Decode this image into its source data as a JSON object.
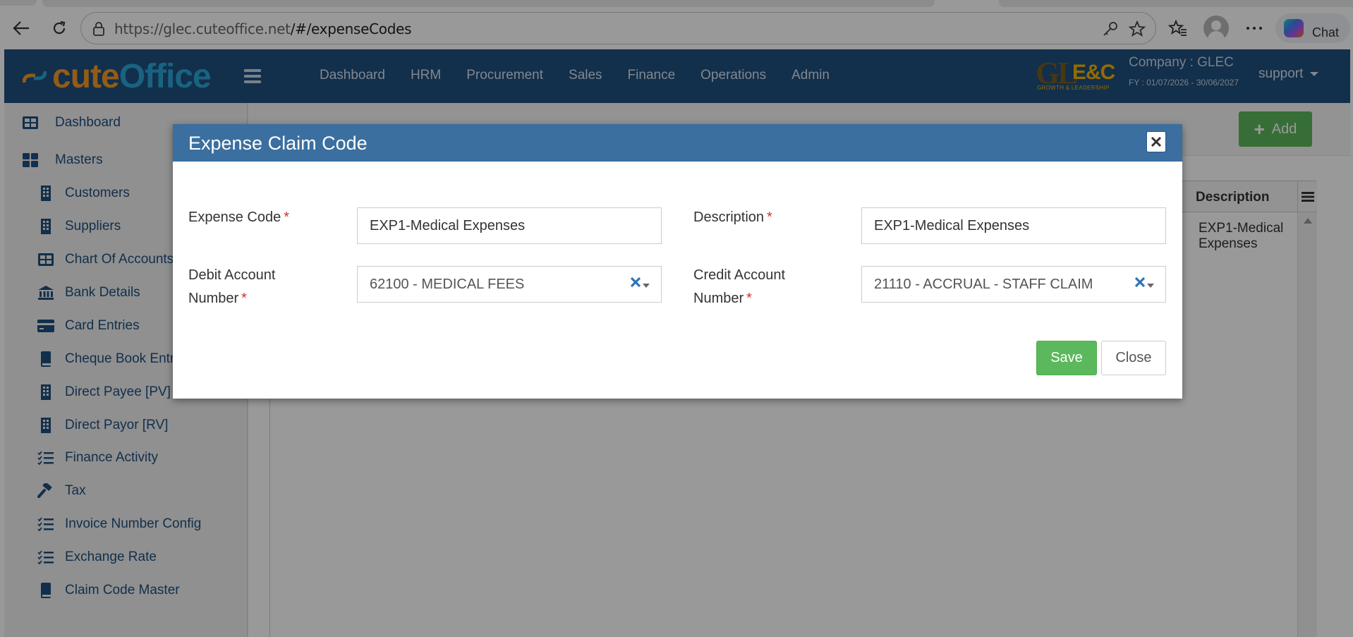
{
  "browser": {
    "url_host": "https://glec.cuteoffice.net",
    "url_path": "/#/expenseCodes",
    "chat_label": "Chat"
  },
  "brand": {
    "part1": "cute",
    "part2": "Office"
  },
  "logo": {
    "gl": "GL",
    "ec": "E&C",
    "tagline": "GROWTH & LEADERSHIP"
  },
  "nav": {
    "items": [
      "Dashboard",
      "HRM",
      "Procurement",
      "Sales",
      "Finance",
      "Operations",
      "Admin"
    ]
  },
  "company": {
    "name": "Company : GLEC",
    "fy": "FY : 01/07/2026 - 30/06/2027",
    "user": "support"
  },
  "sidebar": {
    "dashboard": "Dashboard",
    "masters": "Masters",
    "items": [
      {
        "label": "Customers",
        "icon": "building-icon"
      },
      {
        "label": "Suppliers",
        "icon": "building-icon"
      },
      {
        "label": "Chart Of Accounts",
        "icon": "table-icon"
      },
      {
        "label": "Bank Details",
        "icon": "bank-icon"
      },
      {
        "label": "Card Entries",
        "icon": "credit-card-icon"
      },
      {
        "label": "Cheque Book Entry",
        "icon": "book-icon"
      },
      {
        "label": "Direct Payee [PV]",
        "icon": "building-icon"
      },
      {
        "label": "Direct Payor [RV]",
        "icon": "building-icon"
      },
      {
        "label": "Finance Activity",
        "icon": "list-check-icon"
      },
      {
        "label": "Tax",
        "icon": "gavel-icon"
      },
      {
        "label": "Invoice Number Config",
        "icon": "list-check-icon"
      },
      {
        "label": "Exchange Rate",
        "icon": "list-check-icon"
      },
      {
        "label": "Claim Code Master",
        "icon": "book-icon"
      }
    ]
  },
  "page": {
    "add_label": "Add",
    "grid_col": "Description",
    "grid_cell": "EXP1-Medical Expenses"
  },
  "modal": {
    "title": "Expense Claim Code",
    "expense_code_label": "Expense Code",
    "expense_code_value": "EXP1-Medical Expenses",
    "description_label": "Description",
    "description_value": "EXP1-Medical Expenses",
    "debit_label_1": "Debit Account",
    "debit_label_2": "Number",
    "debit_value": "62100 - MEDICAL FEES",
    "credit_label_1": "Credit Account",
    "credit_label_2": "Number",
    "credit_value": "21110 - ACCRUAL - STAFF CLAIM",
    "required_mark": "*",
    "save_label": "Save",
    "close_label": "Close"
  },
  "colors": {
    "nav_bg": "#1f4f7d",
    "modal_header": "#3a6fa0",
    "success": "#5cb85c",
    "required": "#d32f2f"
  }
}
